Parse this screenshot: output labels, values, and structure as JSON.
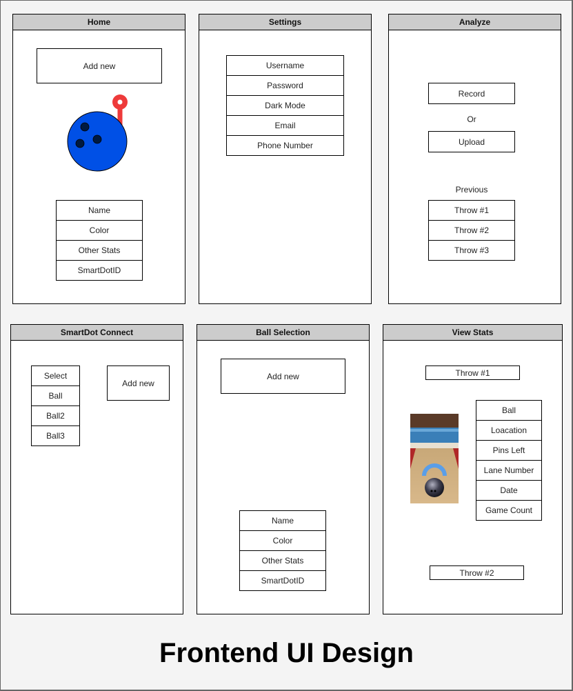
{
  "title": "Frontend UI Design",
  "colors": {
    "background": "#f4f4f4",
    "header": "#cccccc",
    "ball": "#0050e6",
    "ball_holes": "#001a40",
    "pin": "#ee3a3a"
  },
  "screens": {
    "home": {
      "header": "Home",
      "add_new": "Add new",
      "ball_icon": "bowling-ball-icon",
      "fields": [
        "Name",
        "Color",
        "Other Stats",
        "SmartDotID"
      ]
    },
    "settings": {
      "header": "Settings",
      "items": [
        "Username",
        "Password",
        "Dark Mode",
        "Email",
        "Phone Number"
      ]
    },
    "analyze": {
      "header": "Analyze",
      "record": "Record",
      "or": "Or",
      "upload": "Upload",
      "previous_label": "Previous",
      "previous": [
        "Throw #1",
        "Throw #2",
        "Throw #3"
      ]
    },
    "smartdot_connect": {
      "header": "SmartDot Connect",
      "select_list": [
        "Select",
        "Ball",
        "Ball2",
        "Ball3"
      ],
      "add_new": "Add new"
    },
    "ball_selection": {
      "header": "Ball Selection",
      "add_new": "Add new",
      "fields": [
        "Name",
        "Color",
        "Other Stats",
        "SmartDotID"
      ]
    },
    "view_stats": {
      "header": "View Stats",
      "throw1": "Throw #1",
      "image": "bowling-lane-image",
      "stats": [
        "Ball",
        "Loacation",
        "Pins Left",
        "Lane Number",
        "Date",
        "Game Count"
      ],
      "throw2": "Throw #2"
    }
  }
}
